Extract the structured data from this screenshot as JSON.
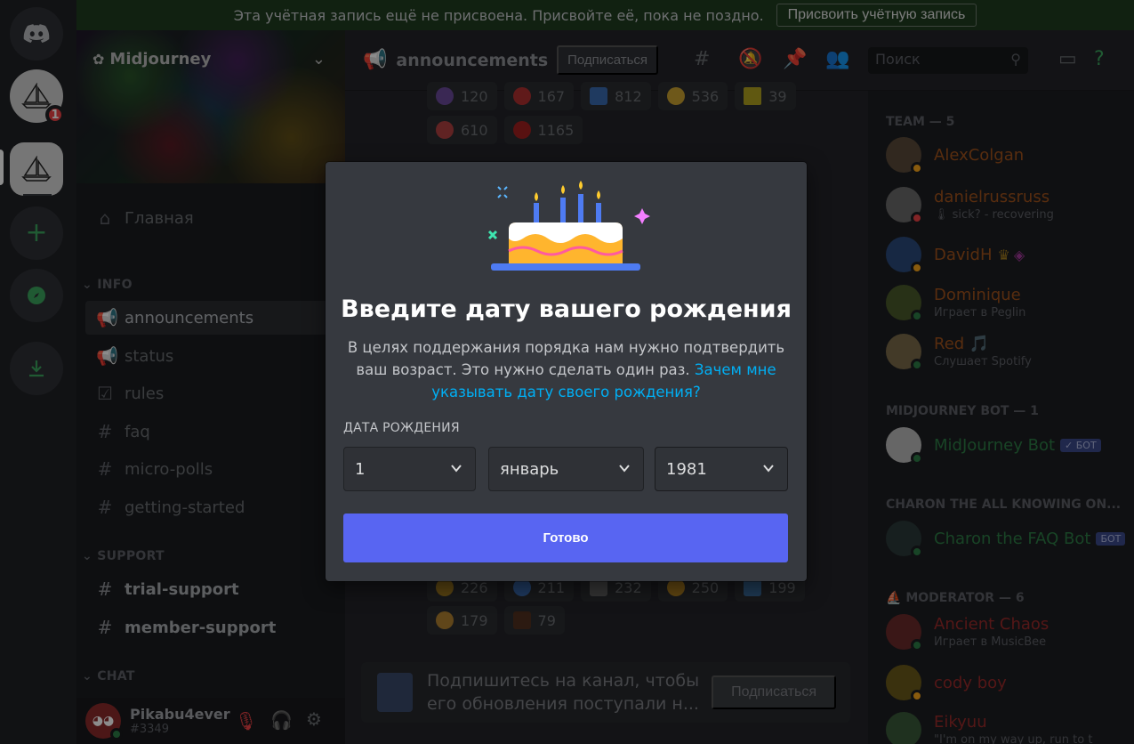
{
  "banner": {
    "text": "Эта учётная запись ещё не присвоена. Присвойте её, пока не поздно.",
    "button": "Присвоить учётную запись"
  },
  "rail": {
    "badge": "1"
  },
  "server": {
    "name": "Midjourney",
    "home": "Главная",
    "categories": {
      "info": "INFO",
      "support": "SUPPORT",
      "chat": "CHAT"
    },
    "channels": [
      "announcements",
      "status",
      "rules",
      "faq",
      "micro-polls",
      "getting-started",
      "trial-support",
      "member-support"
    ]
  },
  "user": {
    "name": "Pikabu4ever",
    "tag": "#3349"
  },
  "header": {
    "channel": "announcements",
    "subscribe": "Подписаться",
    "search_placeholder": "Поиск"
  },
  "reactions_top": [
    {
      "count": "120",
      "color": "#6a4a9a"
    },
    {
      "count": "167",
      "color": "#b03030"
    },
    {
      "count": "812",
      "color": "#3a6ab0"
    },
    {
      "count": "536",
      "color": "#c8a030"
    },
    {
      "count": "39",
      "color": "#b0a020"
    }
  ],
  "reactions_top2": [
    {
      "count": "610",
      "color": "#b04040"
    },
    {
      "count": "1165",
      "color": "#a02020"
    }
  ],
  "reactions_bottom": [
    {
      "count": "226",
      "color": "#a07a20"
    },
    {
      "count": "211",
      "color": "#3a6ab0"
    },
    {
      "count": "232",
      "color": "#606060"
    },
    {
      "count": "250",
      "color": "#b08020"
    },
    {
      "count": "199",
      "color": "#3a6a9a"
    }
  ],
  "reactions_bottom2": [
    {
      "count": "179",
      "color": "#b08030"
    },
    {
      "count": "79",
      "color": "#503020"
    }
  ],
  "subscribe_card": {
    "text": "Подпишитесь на канал, чтобы его обновления поступали н...",
    "button": "Подписаться"
  },
  "members": {
    "team_label": "TEAM — 5",
    "team": [
      {
        "name": "AlexColgan",
        "color": "#a0521d",
        "sub": ""
      },
      {
        "name": "danielrussruss",
        "color": "#a0521d",
        "sub": "🌡 sick? - recovering"
      },
      {
        "name": "DavidH",
        "color": "#a0521d",
        "sub": ""
      },
      {
        "name": "Dominique",
        "color": "#a0521d",
        "sub": "Играет в Peglin"
      },
      {
        "name": "Red 🎵",
        "color": "#a0521d",
        "sub": "Слушает Spotify"
      }
    ],
    "bot_label": "MIDJOURNEY BOT — 1",
    "bot": {
      "name": "MidJourney Bot",
      "badge": "✓ БОТ",
      "color": "#2d7d46"
    },
    "charon_label": "CHARON THE ALL KNOWING ON...",
    "charon": {
      "name": "Charon the FAQ Bot",
      "badge": "БОТ",
      "color": "#2d7d46"
    },
    "mod_label": "MODERATOR — 6",
    "mods": [
      {
        "name": "Ancient Chaos",
        "color": "#9a2a2a",
        "sub": "Играет в MusicBee"
      },
      {
        "name": "cody boy",
        "color": "#9a2a2a",
        "sub": ""
      },
      {
        "name": "Eikyuu",
        "color": "#9a2a2a",
        "sub": "\"I'm on my way up, run to t"
      }
    ]
  },
  "modal": {
    "title": "Введите дату вашего рождения",
    "desc": "В целях поддержания порядка нам нужно подтвердить ваш возраст. Это нужно сделать один раз.",
    "link": "Зачем мне указывать дату своего рождения?",
    "label": "ДАТА РОЖДЕНИЯ",
    "day": "1",
    "month": "январь",
    "year": "1981",
    "submit": "Готово"
  },
  "colors": {
    "accent": "#5865f2",
    "link": "#00aff4",
    "online": "#2d7d46",
    "badge": "#ed4245"
  }
}
